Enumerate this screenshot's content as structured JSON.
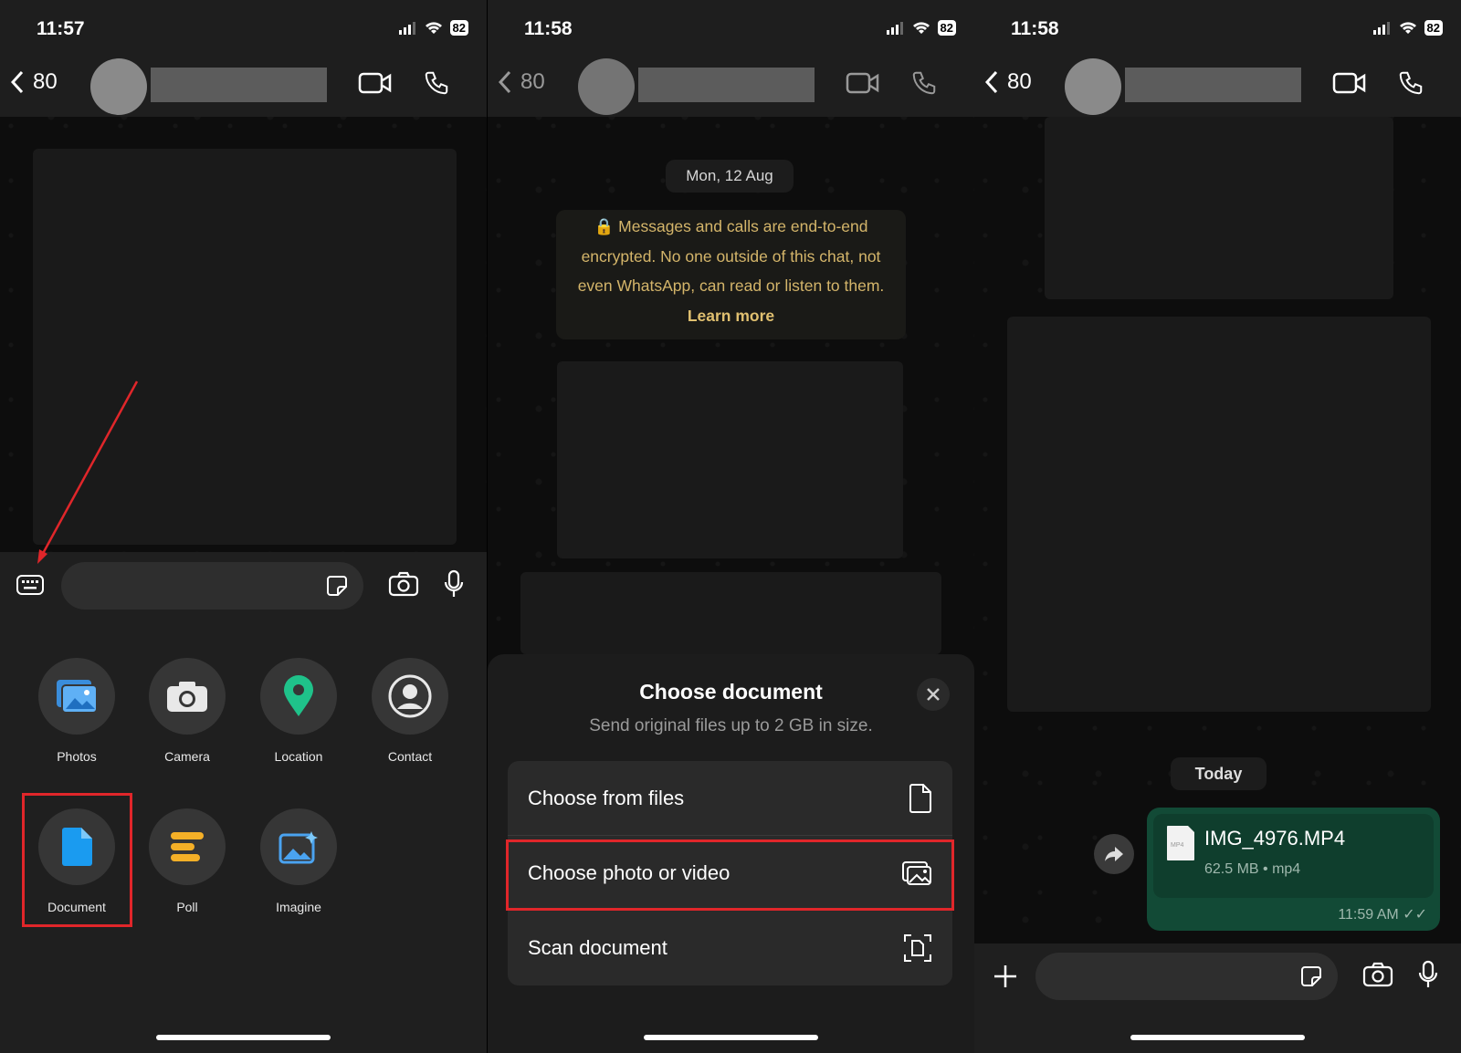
{
  "panels": [
    {
      "time": "11:57",
      "battery": "82",
      "back_count": "80"
    },
    {
      "time": "11:58",
      "battery": "82",
      "back_count": "80"
    },
    {
      "time": "11:58",
      "battery": "82",
      "back_count": "80"
    }
  ],
  "attachments": [
    {
      "label": "Photos",
      "icon": "photos-icon"
    },
    {
      "label": "Camera",
      "icon": "camera-icon"
    },
    {
      "label": "Location",
      "icon": "location-pin-icon"
    },
    {
      "label": "Contact",
      "icon": "contact-icon"
    },
    {
      "label": "Document",
      "icon": "document-icon"
    },
    {
      "label": "Poll",
      "icon": "poll-icon"
    },
    {
      "label": "Imagine",
      "icon": "imagine-icon"
    }
  ],
  "chat2": {
    "date": "Mon, 12 Aug",
    "encryption": "Messages and calls are end-to-end encrypted. No one outside of this chat, not even WhatsApp, can read or listen to them.",
    "learn_more": "Learn more"
  },
  "sheet": {
    "title": "Choose document",
    "subtitle": "Send original files up to 2 GB in size.",
    "options": [
      {
        "label": "Choose from files"
      },
      {
        "label": "Choose photo or video"
      },
      {
        "label": "Scan document"
      }
    ]
  },
  "chat3": {
    "day": "Today",
    "file_name": "IMG_4976.MP4",
    "file_meta": "62.5 MB • mp4",
    "file_badge": "MP4",
    "time": "11:59 AM"
  },
  "colors": {
    "highlight": "#e0262a",
    "bubble": "#124a36",
    "doc": "#1a9bf0",
    "location": "#1fc28a",
    "poll": "#f5b027"
  }
}
